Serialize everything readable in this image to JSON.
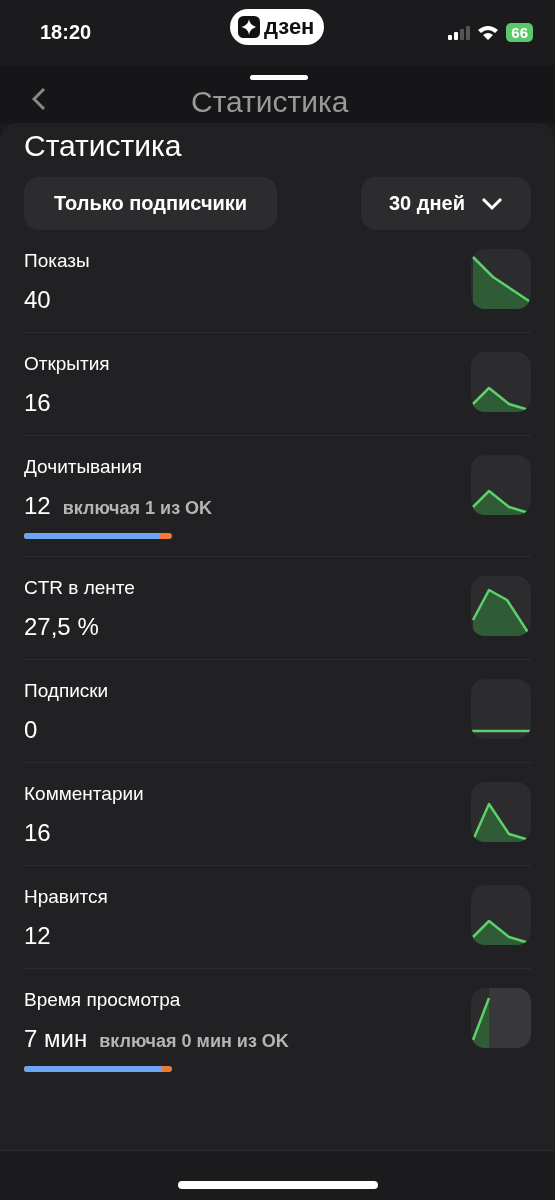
{
  "status_bar": {
    "time": "18:20",
    "app_badge": "дзен",
    "battery": "66"
  },
  "nav": {
    "title": "Статистика"
  },
  "sheet": {
    "title": "Статистика",
    "filters": [
      {
        "label": "Только подписчики",
        "kind": "toggle"
      },
      {
        "label": "30 дней",
        "kind": "dropdown"
      }
    ],
    "metrics": [
      {
        "label": "Показы",
        "value": "40"
      },
      {
        "label": "Открытия",
        "value": "16"
      },
      {
        "label": "Дочитывания",
        "value": "12",
        "note": "включая 1 из OK",
        "level": 0.92
      },
      {
        "label": "CTR в ленте",
        "value": "27,5 %"
      },
      {
        "label": "Подписки",
        "value": "0"
      },
      {
        "label": "Комментарии",
        "value": "16"
      },
      {
        "label": "Нравится",
        "value": "12"
      },
      {
        "label": "Время просмотра",
        "value": "7 мин",
        "note": "включая 0 мин из OK",
        "level": 0.93
      }
    ]
  }
}
